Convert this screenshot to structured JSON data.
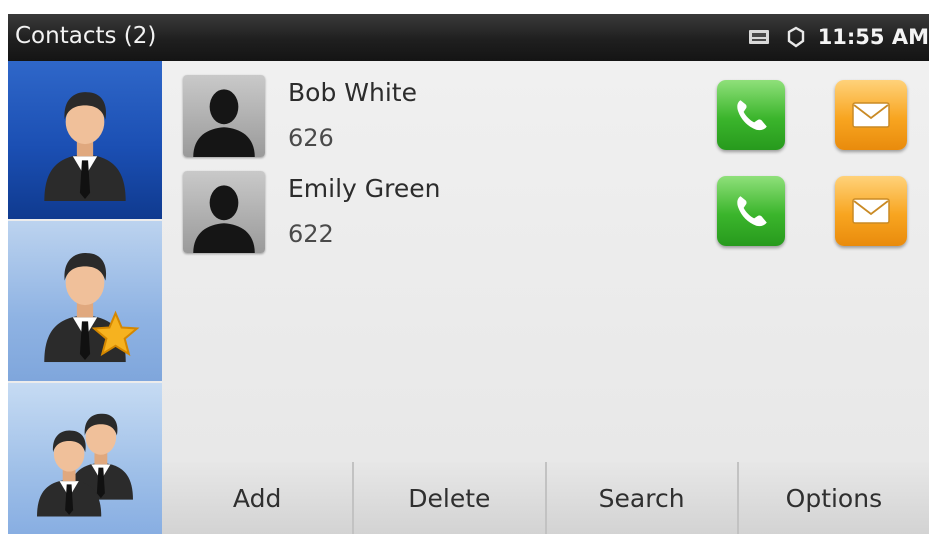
{
  "status_bar": {
    "title": "Contacts (2)",
    "time": "11:55 AM",
    "icons": [
      "message-icon",
      "network-icon"
    ]
  },
  "sidebar": {
    "items": [
      {
        "id": "directory",
        "icon": "contact-person-icon",
        "selected": true
      },
      {
        "id": "favorites",
        "icon": "favorite-contact-star-icon",
        "selected": false
      },
      {
        "id": "groups",
        "icon": "contact-group-icon",
        "selected": false
      }
    ]
  },
  "contacts": [
    {
      "name": "Bob White",
      "number": "626"
    },
    {
      "name": "Emily Green",
      "number": "622"
    }
  ],
  "softkeys": {
    "add": "Add",
    "delete": "Delete",
    "search": "Search",
    "options": "Options"
  },
  "colors": {
    "status_bar_bg": "#1f1f1f",
    "selected_tab": "#1b4fb3",
    "unselected_tab": "#8fb3e3",
    "call_button": "#3bb52c",
    "mail_button": "#f8a520"
  }
}
